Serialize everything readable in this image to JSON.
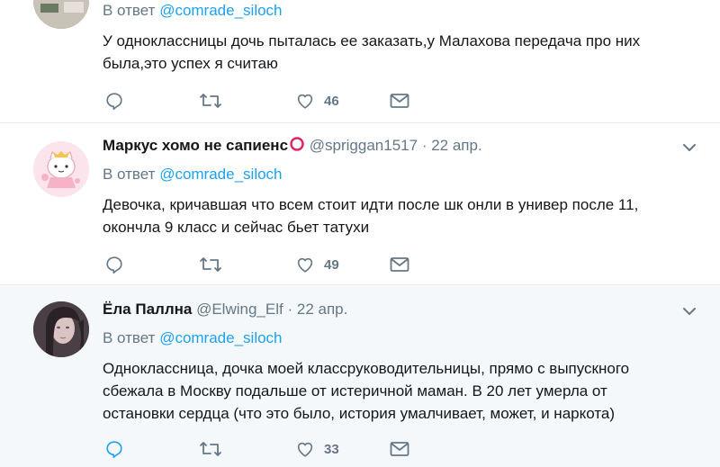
{
  "tweets": [
    {
      "reply_prefix": "В ответ",
      "reply_mention": "@comrade_siloch",
      "text_lines": [
        "У одноклассницы дочь пыталась ее заказать,у Малахова передача про них",
        "была,это успех я считаю"
      ],
      "likes": "46",
      "reply_count": "",
      "retweet_count": ""
    },
    {
      "name": "Маркус хомо не сапиенс",
      "handle": "@spriggan1517",
      "separator": "·",
      "date": "22 апр.",
      "reply_prefix": "В ответ",
      "reply_mention": "@comrade_siloch",
      "text_lines": [
        "Девочка, кричавшая что всем стоит идти после шк онли в универ после 11,",
        "окончла 9 класс и сейчас бьет татухи"
      ],
      "likes": "49",
      "reply_count": "",
      "retweet_count": ""
    },
    {
      "name": "Ёла Паллна",
      "handle": "@Elwing_Elf",
      "separator": "·",
      "date": "22 апр.",
      "reply_prefix": "В ответ",
      "reply_mention": "@comrade_siloch",
      "text_lines": [
        "Одноклассница, дочка моей классруководительницы, прямо с выпускного",
        "сбежала в Москву подальше от истеричной маман. В 20 лет умерла от",
        "остановки сердца (что это было, история умалчивает, может, и наркота)"
      ],
      "likes": "33",
      "reply_count": "",
      "retweet_count": ""
    }
  ],
  "icons": {
    "reply": "reply-icon",
    "retweet": "retweet-icon",
    "like": "heart-icon",
    "dm": "envelope-icon",
    "caret": "chevron-down-icon",
    "name_mark": "red-ring-icon"
  },
  "colors": {
    "text": "#14171a",
    "secondary": "#657786",
    "link": "#1da1f2",
    "highlight_bg": "#f5f8fa",
    "active_reply": "#1da1f2",
    "name_ring": "#e0245e"
  }
}
